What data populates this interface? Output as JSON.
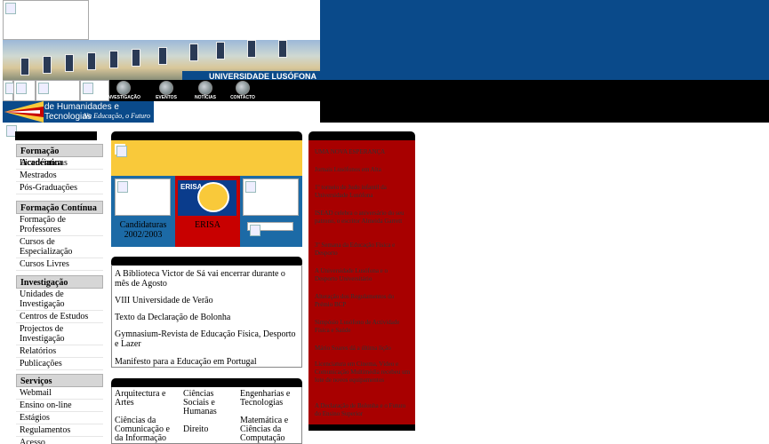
{
  "header": {
    "brand": "UNIVERSIDADE LUSÓFONA",
    "nav_icons": [
      {
        "label": "INVESTIGAÇÃO",
        "icon": "research-icon"
      },
      {
        "label": "EVENTOS",
        "icon": "events-icon"
      },
      {
        "label": "NOTÍCIAS",
        "icon": "news-icon"
      },
      {
        "label": "CONTACTO",
        "icon": "contact-icon"
      }
    ],
    "faculty_name": "de Humanidades e Tecnologias",
    "faculty_tagline": "Na Educação, o Futuro"
  },
  "sidebar": {
    "sections": [
      {
        "title": "Formação Académica",
        "items": [
          "Licenciaturas",
          "Mestrados",
          "Pós-Graduações"
        ]
      },
      {
        "title": "Formação Contínua",
        "items": [
          "Formação de Professores",
          "Cursos de Especialização",
          "Cursos Livres"
        ]
      },
      {
        "title": "Investigação",
        "items": [
          "Unidades de Investigação",
          "Centros de Estudos",
          "Projectos de Investigação",
          "Relatórios",
          "Publicações"
        ]
      },
      {
        "title": "Serviços",
        "items": [
          "Webmail",
          "Ensino on-line",
          "Estágios",
          "Regulamentos",
          "Acesso"
        ]
      }
    ]
  },
  "promo": {
    "candidaturas": "Candidaturas 2002/2003",
    "erisa_logo_text": "ERISA",
    "erisa_label": "ERISA"
  },
  "news": [
    "A Biblioteca Victor de Sá vai encerrar durante o mês de Agosto",
    "VIII Universidade de Verão",
    "Texto da Declaração de Bolonha",
    "Gymnasium-Revista de Educação Física, Desporto e Lazer",
    "Manifesto para a Educação em Portugal"
  ],
  "areas": [
    "Arquitectura e Artes",
    "Ciências Sociais e Humanas",
    "Engenharias e Tecnologias",
    "Ciências da Comunicação e da Informação",
    "Direito",
    "Matemática e Ciências da Computação"
  ],
  "right_news": [
    "UMA NOVA ESPERANÇA",
    "Jornais Lusófonos em Alta",
    "1º torneio de Judo infantil da Universidade Lusófona",
    "ISEAD celebra o aniversário do seu patrono, o escritor Almeida Garrett",
    "3º Semana da Educação Física e Desporto",
    "A Universidade Lusófona e o Desporto Universitário",
    "Alteração dos Regulamentos do Prémio BCP",
    "Simpósio Lusófono de Actividade Física e Saúde",
    "Mário Soares dá a última lição",
    "Licenciatura em Cinema, Vídeo e Comunicação Multimédia recebeu um lote de novos equipamentos",
    "A Declaração de Bolonha e o Futuro do Ensino Superior"
  ],
  "colors": {
    "brand_blue": "#0a4a8a",
    "accent_red": "#a80000",
    "accent_yellow": "#f9c93a"
  }
}
